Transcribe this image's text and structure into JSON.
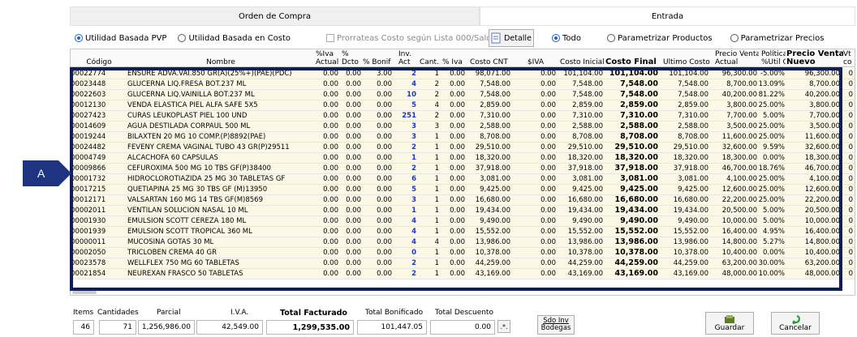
{
  "header": {
    "orden_title": "Orden de Compra",
    "entrada_title": "Entrada"
  },
  "options_left": {
    "utilidad_pvp": "Utilidad Basada PVP",
    "utilidad_costo": "Utilidad Basada en Costo",
    "prorrateas": "Prorrateas Costo según Lista 000/SaldoInv",
    "detalle": "Detalle"
  },
  "options_right": {
    "todo": "Todo",
    "param_productos": "Parametrizar Productos",
    "param_precios": "Parametrizar Precios"
  },
  "columns": {
    "codigo": "Código",
    "nombre": "Nombre",
    "iva_actual": "%Iva\nActual",
    "pct_dcto": "%\nDcto",
    "pct_bonif": "% Bonif",
    "inv_act": "Inv.\nAct",
    "cant": "Cant.",
    "pct_iva": "% Iva",
    "costo_cnt": "Costo CNT",
    "s_iva": "$IVA",
    "costo_inicial": "Costo Inicial",
    "costo_final": "Costo Final",
    "ultimo_costo": "Ultimo Costo",
    "precio_venta_actual": "Precio Venta\nActual",
    "politica": "Política\n%Util Cia",
    "precio_venta_nuevo": "Precio Venta\nNuevo",
    "vt": "Vt\nco"
  },
  "rows": [
    {
      "codigo": "00022774",
      "nombre": "ENSURE ADVA.VAI.850 GR(A)(25%+)(PAE)(PDC)",
      "iva": "0.00",
      "dcto": "0.00",
      "bonif": "3.00",
      "inv": "2",
      "cant": "1",
      "piva": "0.00",
      "cnt": "98,071.00",
      "siva": "0.00",
      "ini": "101,104.00",
      "fin": "101,104.00",
      "ult": "101,104.00",
      "pva": "96,300.00",
      "pol": "-5.00%",
      "pvn": "96,300.00",
      "vt": "0"
    },
    {
      "codigo": "00023448",
      "nombre": "GLUCERNA LIQ.FRESA BOT.237 ML",
      "iva": "0.00",
      "dcto": "0.00",
      "bonif": "0.00",
      "inv": "4",
      "cant": "2",
      "piva": "0.00",
      "cnt": "7,548.00",
      "siva": "0.00",
      "ini": "7,548.00",
      "fin": "7,548.00",
      "ult": "7,548.00",
      "pva": "8,700.00",
      "pol": "13.09%",
      "pvn": "8,700.00",
      "vt": "0"
    },
    {
      "codigo": "00022603",
      "nombre": "GLUCERNA LIQ.VAINILLA BOT.237 ML",
      "iva": "0.00",
      "dcto": "0.00",
      "bonif": "0.00",
      "inv": "10",
      "cant": "2",
      "piva": "0.00",
      "cnt": "7,548.00",
      "siva": "0.00",
      "ini": "7,548.00",
      "fin": "7,548.00",
      "ult": "7,548.00",
      "pva": "40,200.00",
      "pol": "81.22%",
      "pvn": "40,200.00",
      "vt": "0"
    },
    {
      "codigo": "00012130",
      "nombre": "VENDA ELASTICA PIEL ALFA SAFE 5X5",
      "iva": "0.00",
      "dcto": "0.00",
      "bonif": "0.00",
      "inv": "5",
      "cant": "4",
      "piva": "0.00",
      "cnt": "2,859.00",
      "siva": "0.00",
      "ini": "2,859.00",
      "fin": "2,859.00",
      "ult": "2,859.00",
      "pva": "3,800.00",
      "pol": "25.00%",
      "pvn": "3,800.00",
      "vt": "0"
    },
    {
      "codigo": "00027423",
      "nombre": "CURAS LEUKOPLAST PIEL 100 UND",
      "iva": "0.00",
      "dcto": "0.00",
      "bonif": "0.00",
      "inv": "251",
      "cant": "2",
      "piva": "0.00",
      "cnt": "7,310.00",
      "siva": "0.00",
      "ini": "7,310.00",
      "fin": "7,310.00",
      "ult": "7,310.00",
      "pva": "7,700.00",
      "pol": "5.00%",
      "pvn": "7,700.00",
      "vt": "0"
    },
    {
      "codigo": "00014609",
      "nombre": "AGUA DESTILADA CORPAUL 500 ML",
      "iva": "0.00",
      "dcto": "0.00",
      "bonif": "0.00",
      "inv": "3",
      "cant": "3",
      "piva": "0.00",
      "cnt": "2,588.00",
      "siva": "0.00",
      "ini": "2,588.00",
      "fin": "2,588.00",
      "ult": "2,588.00",
      "pva": "3,500.00",
      "pol": "25.00%",
      "pvn": "3,500.00",
      "vt": "0"
    },
    {
      "codigo": "00019244",
      "nombre": "BILAXTEN 20 MG 10 COMP.(P)8892(PAE)",
      "iva": "0.00",
      "dcto": "0.00",
      "bonif": "0.00",
      "inv": "3",
      "cant": "1",
      "piva": "0.00",
      "cnt": "8,708.00",
      "siva": "0.00",
      "ini": "8,708.00",
      "fin": "8,708.00",
      "ult": "8,708.00",
      "pva": "11,600.00",
      "pol": "25.00%",
      "pvn": "11,600.00",
      "vt": "0"
    },
    {
      "codigo": "00024482",
      "nombre": "FEVENY CREMA VAGINAL TUBO 43 GR(P)29511",
      "iva": "0.00",
      "dcto": "0.00",
      "bonif": "0.00",
      "inv": "2",
      "cant": "1",
      "piva": "0.00",
      "cnt": "29,510.00",
      "siva": "0.00",
      "ini": "29,510.00",
      "fin": "29,510.00",
      "ult": "29,510.00",
      "pva": "32,600.00",
      "pol": "9.59%",
      "pvn": "32,600.00",
      "vt": "0"
    },
    {
      "codigo": "00004749",
      "nombre": "ALCACHOFA 60 CAPSULAS",
      "iva": "0.00",
      "dcto": "0.00",
      "bonif": "0.00",
      "inv": "1",
      "cant": "1",
      "piva": "0.00",
      "cnt": "18,320.00",
      "siva": "0.00",
      "ini": "18,320.00",
      "fin": "18,320.00",
      "ult": "18,320.00",
      "pva": "18,300.00",
      "pol": "0.00%",
      "pvn": "18,300.00",
      "vt": "0"
    },
    {
      "codigo": "00009866",
      "nombre": "CEFUROXIMA 500 MG 10 TBS GF(P)38400",
      "iva": "0.00",
      "dcto": "0.00",
      "bonif": "0.00",
      "inv": "2",
      "cant": "1",
      "piva": "0.00",
      "cnt": "37,918.00",
      "siva": "0.00",
      "ini": "37,918.00",
      "fin": "37,918.00",
      "ult": "37,918.00",
      "pva": "46,700.00",
      "pol": "18.76%",
      "pvn": "46,700.00",
      "vt": "0"
    },
    {
      "codigo": "00001732",
      "nombre": "HIDROCLOROTIAZIDA 25 MG 30 TABLETAS GF",
      "iva": "0.00",
      "dcto": "0.00",
      "bonif": "0.00",
      "inv": "6",
      "cant": "1",
      "piva": "0.00",
      "cnt": "3,081.00",
      "siva": "0.00",
      "ini": "3,081.00",
      "fin": "3,081.00",
      "ult": "3,081.00",
      "pva": "4,100.00",
      "pol": "25.00%",
      "pvn": "4,100.00",
      "vt": "0"
    },
    {
      "codigo": "00017215",
      "nombre": "QUETIAPINA 25 MG 30 TBS GF (M)13950",
      "iva": "0.00",
      "dcto": "0.00",
      "bonif": "0.00",
      "inv": "5",
      "cant": "1",
      "piva": "0.00",
      "cnt": "9,425.00",
      "siva": "0.00",
      "ini": "9,425.00",
      "fin": "9,425.00",
      "ult": "9,425.00",
      "pva": "12,600.00",
      "pol": "25.00%",
      "pvn": "12,600.00",
      "vt": "0"
    },
    {
      "codigo": "00012171",
      "nombre": "VALSARTAN 160 MG 14 TBS GF(M)8569",
      "iva": "0.00",
      "dcto": "0.00",
      "bonif": "0.00",
      "inv": "3",
      "cant": "1",
      "piva": "0.00",
      "cnt": "16,680.00",
      "siva": "0.00",
      "ini": "16,680.00",
      "fin": "16,680.00",
      "ult": "16,680.00",
      "pva": "22,200.00",
      "pol": "25.00%",
      "pvn": "22,200.00",
      "vt": "0"
    },
    {
      "codigo": "00002011",
      "nombre": "VENTILAN SOLUCION NASAL 10 ML",
      "iva": "0.00",
      "dcto": "0.00",
      "bonif": "0.00",
      "inv": "1",
      "cant": "1",
      "piva": "0.00",
      "cnt": "19,434.00",
      "siva": "0.00",
      "ini": "19,434.00",
      "fin": "19,434.00",
      "ult": "19,434.00",
      "pva": "20,500.00",
      "pol": "5.00%",
      "pvn": "20,500.00",
      "vt": "0"
    },
    {
      "codigo": "00001930",
      "nombre": "EMULSION SCOTT CEREZA 180 ML",
      "iva": "0.00",
      "dcto": "0.00",
      "bonif": "0.00",
      "inv": "4",
      "cant": "1",
      "piva": "0.00",
      "cnt": "9,490.00",
      "siva": "0.00",
      "ini": "9,490.00",
      "fin": "9,490.00",
      "ult": "9,490.00",
      "pva": "10,000.00",
      "pol": "5.00%",
      "pvn": "10,000.00",
      "vt": "0"
    },
    {
      "codigo": "00001939",
      "nombre": "EMULSION SCOTT TROPICAL 360 ML",
      "iva": "0.00",
      "dcto": "0.00",
      "bonif": "0.00",
      "inv": "4",
      "cant": "1",
      "piva": "0.00",
      "cnt": "15,552.00",
      "siva": "0.00",
      "ini": "15,552.00",
      "fin": "15,552.00",
      "ult": "15,552.00",
      "pva": "16,400.00",
      "pol": "4.95%",
      "pvn": "16,400.00",
      "vt": "0"
    },
    {
      "codigo": "00000011",
      "nombre": "MUCOSINA GOTAS 30 ML",
      "iva": "0.00",
      "dcto": "0.00",
      "bonif": "0.00",
      "inv": "4",
      "cant": "4",
      "piva": "0.00",
      "cnt": "13,986.00",
      "siva": "0.00",
      "ini": "13,986.00",
      "fin": "13,986.00",
      "ult": "13,986.00",
      "pva": "14,800.00",
      "pol": "5.27%",
      "pvn": "14,800.00",
      "vt": "0"
    },
    {
      "codigo": "00002050",
      "nombre": "TRICLOBEN CREMA 40 GR",
      "iva": "0.00",
      "dcto": "0.00",
      "bonif": "0.00",
      "inv": "0",
      "cant": "1",
      "piva": "0.00",
      "cnt": "10,378.00",
      "siva": "0.00",
      "ini": "10,378.00",
      "fin": "10,378.00",
      "ult": "10,378.00",
      "pva": "10,400.00",
      "pol": "0.00%",
      "pvn": "10,400.00",
      "vt": "0"
    },
    {
      "codigo": "00023578",
      "nombre": "WELLFLEX 750 MG 60 TABLETAS",
      "iva": "0.00",
      "dcto": "0.00",
      "bonif": "0.00",
      "inv": "2",
      "cant": "1",
      "piva": "0.00",
      "cnt": "44,259.00",
      "siva": "0.00",
      "ini": "44,259.00",
      "fin": "44,259.00",
      "ult": "44,259.00",
      "pva": "63,200.00",
      "pol": "30.00%",
      "pvn": "63,200.00",
      "vt": "0"
    },
    {
      "codigo": "00021854",
      "nombre": "NEUREXAN FRASCO 50 TABLETAS",
      "iva": "0.00",
      "dcto": "0.00",
      "bonif": "0.00",
      "inv": "2",
      "cant": "1",
      "piva": "0.00",
      "cnt": "43,169.00",
      "siva": "0.00",
      "ini": "43,169.00",
      "fin": "43,169.00",
      "ult": "43,169.00",
      "pva": "48,000.00",
      "pol": "10.00%",
      "pvn": "48,000.00",
      "vt": "0"
    }
  ],
  "annotation": {
    "label": "A",
    "color": "#1f3480"
  },
  "footer": {
    "items_label": "Items",
    "items_value": "46",
    "cantidades_label": "Cantidades",
    "cantidades_value": "71",
    "parcial_label": "Parcial",
    "parcial_value": "1,256,986.00",
    "iva_label": "I.V.A.",
    "iva_value": "42,549.00",
    "total_facturado_label": "Total Facturado",
    "total_facturado_value": "1,299,535.00",
    "total_bonificado_label": "Total Bonificado",
    "total_bonificado_value": "101,447.05",
    "total_descuento_label": "Total Descuento",
    "total_descuento_value": "0.00",
    "sdo_inv": "Sdo Inv",
    "bodegas": "Bodegas",
    "guardar": "Guardar",
    "cancelar": "Cancelar"
  },
  "colors": {
    "selection_border": "#0d1f55",
    "bold_blue": "#1c38c8",
    "row_bg": "#fbf8e6"
  }
}
